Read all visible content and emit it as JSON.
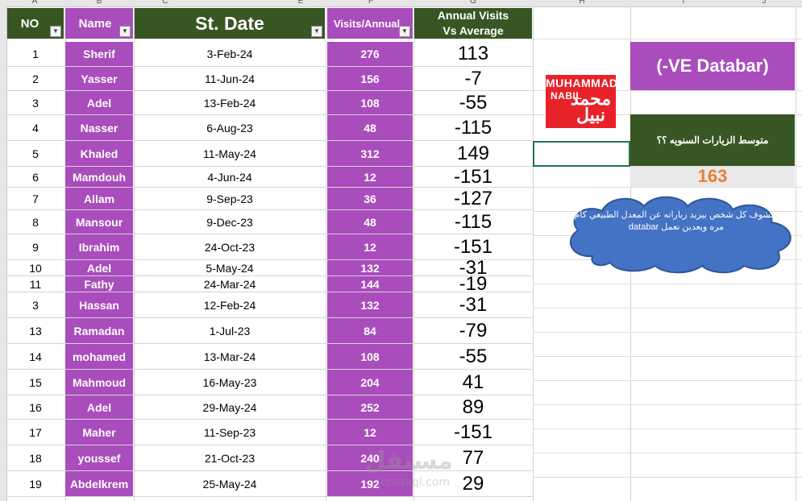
{
  "column_letters": [
    "A",
    "B",
    "C",
    "E",
    "F",
    "G",
    "H",
    "I",
    "J"
  ],
  "headers": {
    "no": "NO",
    "name": "Name",
    "date": "St. Date",
    "visits": "Visits/Annual",
    "diff_line1": "Annual Visits",
    "diff_line2": "Vs Average"
  },
  "rows": [
    {
      "no": "1",
      "name": "Sherif",
      "date": "3-Feb-24",
      "visits": "276",
      "diff": "113"
    },
    {
      "no": "2",
      "name": "Yasser",
      "date": "11-Jun-24",
      "visits": "156",
      "diff": "-7"
    },
    {
      "no": "3",
      "name": "Adel",
      "date": "13-Feb-24",
      "visits": "108",
      "diff": "-55"
    },
    {
      "no": "4",
      "name": "Nasser",
      "date": "6-Aug-23",
      "visits": "48",
      "diff": "-115"
    },
    {
      "no": "5",
      "name": "Khaled",
      "date": "11-May-24",
      "visits": "312",
      "diff": "149"
    },
    {
      "no": "6",
      "name": "Mamdouh",
      "date": "4-Jun-24",
      "visits": "12",
      "diff": "-151"
    },
    {
      "no": "7",
      "name": "Allam",
      "date": "9-Sep-23",
      "visits": "36",
      "diff": "-127"
    },
    {
      "no": "8",
      "name": "Mansour",
      "date": "9-Dec-23",
      "visits": "48",
      "diff": "-115"
    },
    {
      "no": "9",
      "name": "Ibrahim",
      "date": "24-Oct-23",
      "visits": "12",
      "diff": "-151"
    },
    {
      "no": "10",
      "name": "Adel",
      "date": "5-May-24",
      "visits": "132",
      "diff": "-31"
    },
    {
      "no": "11",
      "name": "Fathy",
      "date": "24-Mar-24",
      "visits": "144",
      "diff": "-19"
    },
    {
      "no": "3",
      "name": "Hassan",
      "date": "12-Feb-24",
      "visits": "132",
      "diff": "-31"
    },
    {
      "no": "13",
      "name": "Ramadan",
      "date": "1-Jul-23",
      "visits": "84",
      "diff": "-79"
    },
    {
      "no": "14",
      "name": "mohamed",
      "date": "13-Mar-24",
      "visits": "108",
      "diff": "-55"
    },
    {
      "no": "15",
      "name": "Mahmoud",
      "date": "16-May-23",
      "visits": "204",
      "diff": "41"
    },
    {
      "no": "16",
      "name": "Adel",
      "date": "29-May-24",
      "visits": "252",
      "diff": "89"
    },
    {
      "no": "17",
      "name": "Maher",
      "date": "11-Sep-23",
      "visits": "12",
      "diff": "-151"
    },
    {
      "no": "18",
      "name": "youssef",
      "date": "21-Oct-23",
      "visits": "240",
      "diff": "77"
    },
    {
      "no": "19",
      "name": "Abdelkrem",
      "date": "25-May-24",
      "visits": "192",
      "diff": "29"
    }
  ],
  "panel": {
    "databar_title": "(-VE Databar)",
    "average_label": "متوسط الزيارات السنويه ؟؟",
    "average_value": "163",
    "cloud_text": "هنشوف كل شخص بيزيد زياراته عن المعدل الطبيعي كام مره ويعدين نعمل databar"
  },
  "logo": {
    "line1": "MUHAMMAD",
    "line2": "NABIL",
    "arabic": "محمد نبيل"
  },
  "watermark": {
    "arabic": "مستقل",
    "latin": "mostaql.com"
  },
  "colors": {
    "header_green": "#375623",
    "accent_purple": "#a94cbc",
    "average_orange": "#ed7d31",
    "logo_red": "#e8222a",
    "cloud_blue": "#4472c4"
  }
}
